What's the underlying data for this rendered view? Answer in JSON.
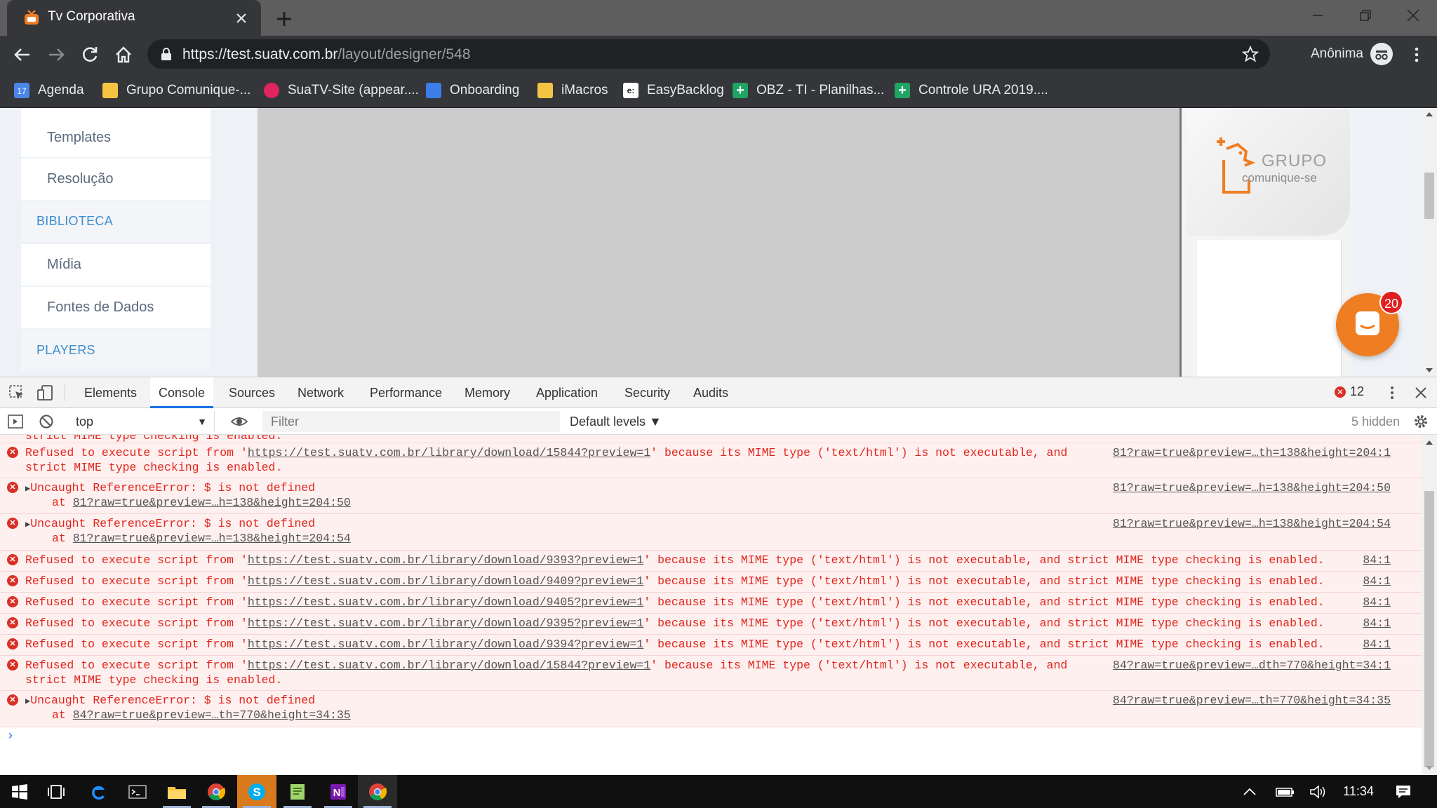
{
  "browser": {
    "tab_title": "Tv Corporativa",
    "url_host": "https://test.suatv.com.br",
    "url_path": "/layout/designer/548",
    "profile_label": "Anônima"
  },
  "bookmarks": [
    {
      "label": "Agenda",
      "icon_color": "#4a86e8",
      "icon_text": "17"
    },
    {
      "label": "Grupo Comunique-...",
      "icon_color": "#f6c443",
      "icon_text": ""
    },
    {
      "label": "SuaTV-Site (appear....",
      "icon_color": "#e0245e",
      "icon_text": ""
    },
    {
      "label": "Onboarding",
      "icon_color": "#3b7de9",
      "icon_text": ""
    },
    {
      "label": "iMacros",
      "icon_color": "#f6c443",
      "icon_text": ""
    },
    {
      "label": "EasyBacklog",
      "icon_color": "#ffffff",
      "icon_text": "e:"
    },
    {
      "label": "OBZ - TI - Planilhas...",
      "icon_color": "#1fa463",
      "icon_text": "+"
    },
    {
      "label": "Controle URA 2019....",
      "icon_color": "#1fa463",
      "icon_text": "+"
    }
  ],
  "sidebar": {
    "items": [
      {
        "label": "Templates",
        "type": "item"
      },
      {
        "label": "Resolução",
        "type": "item"
      },
      {
        "label": "BIBLIOTECA",
        "type": "header"
      },
      {
        "label": "Mídia",
        "type": "item"
      },
      {
        "label": "Fontes de Dados",
        "type": "item"
      },
      {
        "label": "PLAYERS",
        "type": "header"
      }
    ]
  },
  "preview": {
    "logo_line1": "GRUPO",
    "logo_line2": "comunique-se",
    "chat_badge": "20",
    "accent": "#ef7d22"
  },
  "devtools": {
    "tabs": [
      "Elements",
      "Console",
      "Sources",
      "Network",
      "Performance",
      "Memory",
      "Application",
      "Security",
      "Audits"
    ],
    "active_tab": "Console",
    "error_count": "12",
    "context": "top",
    "filter_placeholder": "Filter",
    "levels": "Default levels ▼",
    "hidden": "5 hidden",
    "partial_line": "strict MIME type checking is enabled.",
    "messages": [
      {
        "kind": "refused",
        "prefix": "Refused to execute script from '",
        "link": "https://test.suatv.com.br/library/download/15844?preview=1",
        "suffix": "' because its MIME type ('text/html') is not executable, and",
        "line2": "strict MIME type checking is enabled.",
        "source": "81?raw=true&preview=…th=138&height=204:1"
      },
      {
        "kind": "uncaught",
        "text": "Uncaught ReferenceError: $ is not defined",
        "at": "81?raw=true&preview=…h=138&height=204:50",
        "source": "81?raw=true&preview=…h=138&height=204:50"
      },
      {
        "kind": "uncaught",
        "text": "Uncaught ReferenceError: $ is not defined",
        "at": "81?raw=true&preview=…h=138&height=204:54",
        "source": "81?raw=true&preview=…h=138&height=204:54"
      },
      {
        "kind": "refused1",
        "prefix": "Refused to execute script from '",
        "link": "https://test.suatv.com.br/library/download/9393?preview=1",
        "suffix": "' because its MIME type ('text/html') is not executable, and strict MIME type checking is enabled.",
        "source": "84:1"
      },
      {
        "kind": "refused1",
        "prefix": "Refused to execute script from '",
        "link": "https://test.suatv.com.br/library/download/9409?preview=1",
        "suffix": "' because its MIME type ('text/html') is not executable, and strict MIME type checking is enabled.",
        "source": "84:1"
      },
      {
        "kind": "refused1",
        "prefix": "Refused to execute script from '",
        "link": "https://test.suatv.com.br/library/download/9405?preview=1",
        "suffix": "' because its MIME type ('text/html') is not executable, and strict MIME type checking is enabled.",
        "source": "84:1"
      },
      {
        "kind": "refused1",
        "prefix": "Refused to execute script from '",
        "link": "https://test.suatv.com.br/library/download/9395?preview=1",
        "suffix": "' because its MIME type ('text/html') is not executable, and strict MIME type checking is enabled.",
        "source": "84:1"
      },
      {
        "kind": "refused1",
        "prefix": "Refused to execute script from '",
        "link": "https://test.suatv.com.br/library/download/9394?preview=1",
        "suffix": "' because its MIME type ('text/html') is not executable, and strict MIME type checking is enabled.",
        "source": "84:1"
      },
      {
        "kind": "refused",
        "prefix": "Refused to execute script from '",
        "link": "https://test.suatv.com.br/library/download/15844?preview=1",
        "suffix": "' because its MIME type ('text/html') is not executable, and",
        "line2": "strict MIME type checking is enabled.",
        "source": "84?raw=true&preview=…dth=770&height=34:1"
      },
      {
        "kind": "uncaught",
        "text": "Uncaught ReferenceError: $ is not defined",
        "at": "84?raw=true&preview=…th=770&height=34:35",
        "source": "84?raw=true&preview=…th=770&height=34:35"
      }
    ]
  },
  "taskbar": {
    "time": "11:34",
    "apps": [
      "start-icon",
      "task-view-icon",
      "edge-icon",
      "terminal-icon",
      "file-explorer-icon",
      "chrome-icon",
      "skype-icon",
      "notepad-icon",
      "onenote-icon",
      "chrome-icon"
    ]
  }
}
